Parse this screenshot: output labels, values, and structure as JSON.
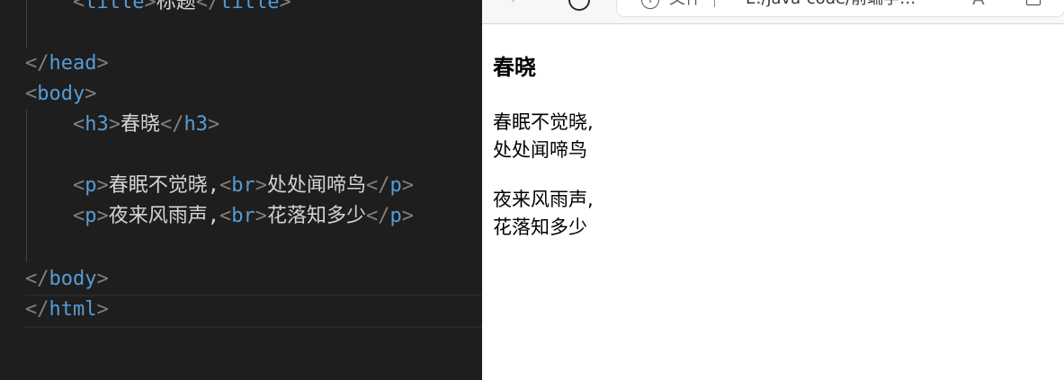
{
  "editor": {
    "lines": {
      "title": {
        "tag": "title",
        "text": "标题"
      },
      "head_close": {
        "tag": "head"
      },
      "body_open": {
        "tag": "body"
      },
      "h3": {
        "tag": "h3",
        "text": "春晓"
      },
      "p1": {
        "tag": "p",
        "br": "br",
        "before": "春眠不觉晓,",
        "after": "处处闻啼鸟"
      },
      "p2": {
        "tag": "p",
        "br": "br",
        "before": "夜来风雨声,",
        "after": "花落知多少"
      },
      "body_close": {
        "tag": "body"
      },
      "html_close": {
        "tag": "html"
      }
    },
    "colors": {
      "background": "#1e1e1e",
      "tag": "#569cd6",
      "bracket": "#808080",
      "text": "#d4d4d4"
    }
  },
  "browser": {
    "back_icon": "back-arrow-icon",
    "refresh_icon": "refresh-icon",
    "address": {
      "info_icon": "info-icon",
      "file_label": "文件",
      "separator": "|",
      "url": "E:/java-code/前端学习/...",
      "read_aloud_icon": "read-aloud-icon",
      "read_aloud_glyph": "A",
      "favorites_icon": "add-favorites-icon"
    },
    "page": {
      "heading": "春晓",
      "p1_line1": "春眠不觉晓,",
      "p1_line2": "处处闻啼鸟",
      "p2_line1": "夜来风雨声,",
      "p2_line2": "花落知多少"
    }
  }
}
